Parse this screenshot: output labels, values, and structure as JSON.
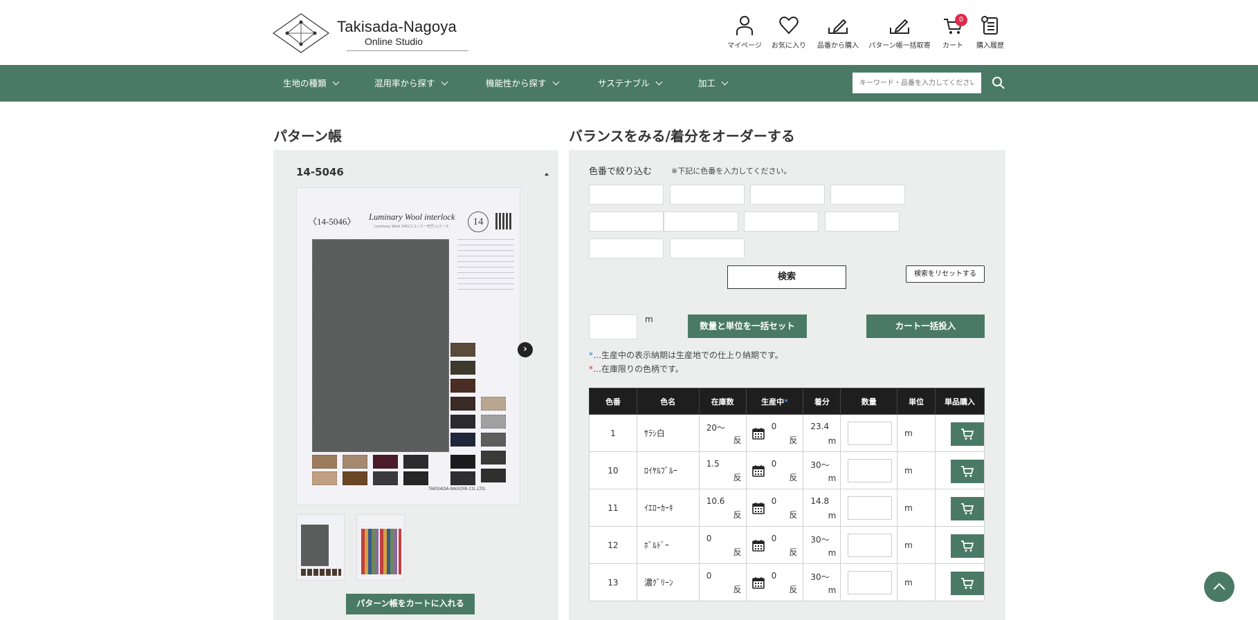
{
  "brand": {
    "title": "Takisada-Nagoya",
    "subtitle": "Online Studio"
  },
  "header_nav": [
    {
      "label": "マイページ",
      "icon": "user-icon"
    },
    {
      "label": "お気に入り",
      "icon": "heart-icon"
    },
    {
      "label": "品番から購入",
      "icon": "pencil-tray-icon"
    },
    {
      "label": "パターン帳一括取寄",
      "icon": "pencil-tray-icon"
    },
    {
      "label": "カート",
      "icon": "cart-icon",
      "badge": "0"
    },
    {
      "label": "購入履歴",
      "icon": "history-icon"
    }
  ],
  "main_nav": [
    {
      "label": "生地の種類"
    },
    {
      "label": "混用率から探す"
    },
    {
      "label": "機能性から探す"
    },
    {
      "label": "サステナブル"
    },
    {
      "label": "加工"
    }
  ],
  "search": {
    "placeholder": "キーワード・品番を入力してください"
  },
  "left": {
    "section_title": "パターン帳",
    "pattern_code": "14-5046",
    "card": {
      "code": "〈14-5046〉",
      "name": "Luminary Wool interlock",
      "sub": "Luminary Wool 14G(エコノミー天竺入(ミース",
      "circle_number": "14",
      "footer": "TAKISADA-NAGOYA CO.,LTD."
    },
    "cart_button": "パターン帳をカートに入れる"
  },
  "right": {
    "section_title": "バランスをみる/着分をオーダーする",
    "filter_label": "色番で絞り込む",
    "filter_note": "※下記に色番を入力してください。",
    "search_button": "検索",
    "reset_button": "検索をリセットする",
    "qty_unit": "m",
    "set_button": "数量と単位を一括セット",
    "bulk_cart_button": "カート一括投入",
    "note1_mark": "*",
    "note1": "…生産中の表示納期は生産地での仕上り納期です。",
    "note2_mark": "*",
    "note2": "…在庫限りの色柄です。",
    "table": {
      "headers": [
        "色番",
        "色名",
        "在庫数",
        "生産中",
        "着分",
        "数量",
        "単位",
        "単品購入"
      ],
      "header_mark": "*",
      "rows": [
        {
          "no": "1",
          "name": "ｻﾗｼ白",
          "stock": "20〜",
          "stock_unit": "反",
          "prod": "0",
          "prod_unit": "反",
          "chakubun": "23.4",
          "chakubun_unit": "m",
          "unit": "m"
        },
        {
          "no": "10",
          "name": "ﾛｲﾔﾙﾌﾞﾙｰ",
          "stock": "1.5",
          "stock_unit": "反",
          "prod": "0",
          "prod_unit": "反",
          "chakubun": "30〜",
          "chakubun_unit": "m",
          "unit": "m"
        },
        {
          "no": "11",
          "name": "ｲｴﾛｰｶｰｷ",
          "stock": "10.6",
          "stock_unit": "反",
          "prod": "0",
          "prod_unit": "反",
          "chakubun": "14.8",
          "chakubun_unit": "m",
          "unit": "m"
        },
        {
          "no": "12",
          "name": "ﾎﾞﾙﾄﾞｰ",
          "stock": "0",
          "stock_unit": "反",
          "prod": "0",
          "prod_unit": "反",
          "chakubun": "30〜",
          "chakubun_unit": "m",
          "unit": "m"
        },
        {
          "no": "13",
          "name": "濃ｸﾞﾘｰﾝ",
          "stock": "0",
          "stock_unit": "反",
          "prod": "0",
          "prod_unit": "反",
          "chakubun": "30〜",
          "chakubun_unit": "m",
          "unit": "m"
        }
      ]
    }
  },
  "colors": {
    "brand_green": "#4a7a66",
    "badge_red": "#e0294a",
    "note_blue": "#3b7ad6"
  }
}
